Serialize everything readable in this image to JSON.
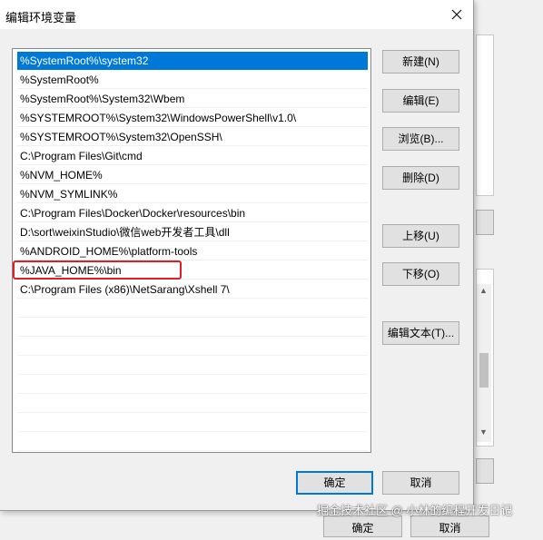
{
  "dialog": {
    "title": "编辑环境变量",
    "close_glyph": "✕"
  },
  "path_entries": [
    "%SystemRoot%\\system32",
    "%SystemRoot%",
    "%SystemRoot%\\System32\\Wbem",
    "%SYSTEMROOT%\\System32\\WindowsPowerShell\\v1.0\\",
    "%SYSTEMROOT%\\System32\\OpenSSH\\",
    "C:\\Program Files\\Git\\cmd",
    "%NVM_HOME%",
    "%NVM_SYMLINK%",
    "C:\\Program Files\\Docker\\Docker\\resources\\bin",
    "D:\\sort\\weixinStudio\\微信web开发者工具\\dll",
    "%ANDROID_HOME%\\platform-tools",
    "%JAVA_HOME%\\bin",
    "C:\\Program Files (x86)\\NetSarang\\Xshell 7\\"
  ],
  "selected_index": 0,
  "highlighted_index": 11,
  "buttons": {
    "new": "新建(N)",
    "edit": "编辑(E)",
    "browse": "浏览(B)...",
    "delete": "删除(D)",
    "move_up": "上移(U)",
    "move_down": "下移(O)",
    "edit_text": "编辑文本(T)...",
    "ok": "确定",
    "cancel": "取消"
  },
  "background_window": {
    "ok": "确定",
    "cancel": "取消"
  },
  "watermark": "掘金技术社区 @ 小林的编程开发日记",
  "colors": {
    "selection": "#0078d7",
    "highlight_box": "#e02020",
    "default_button_border": "#0078d7"
  }
}
